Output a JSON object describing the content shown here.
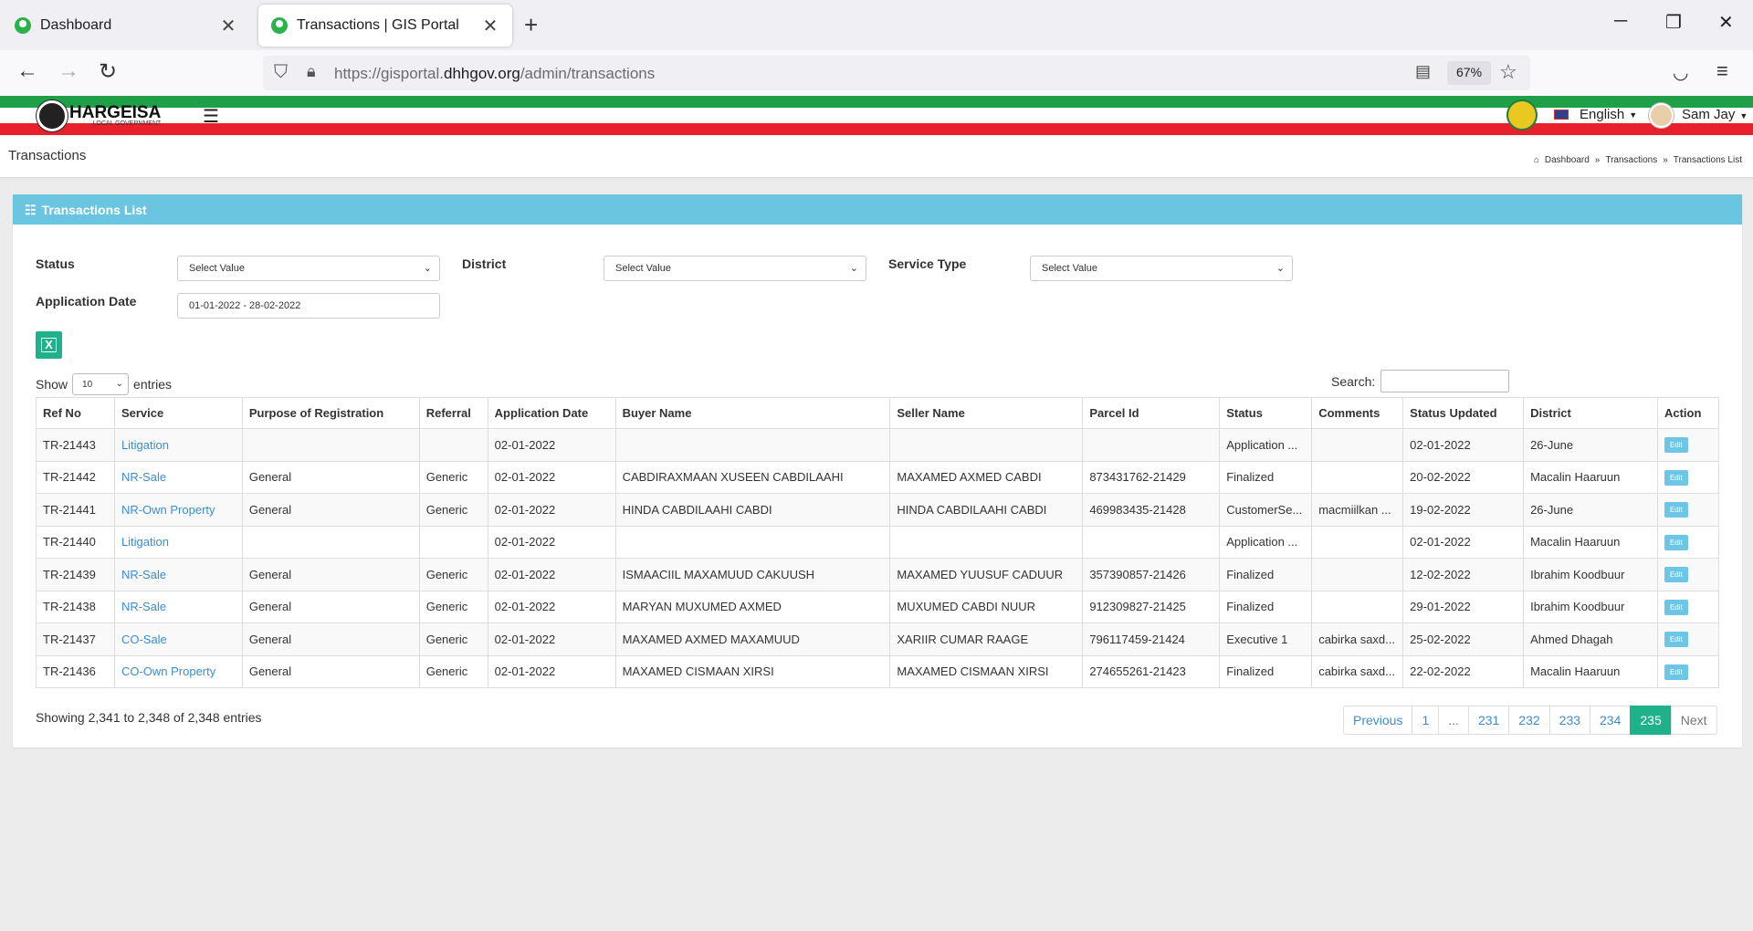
{
  "browser": {
    "tabs": [
      {
        "title": "Dashboard",
        "active": false
      },
      {
        "title": "Transactions | GIS Portal",
        "active": true
      }
    ],
    "url_prefix": "https://gisportal.",
    "url_domain": "dhhgov.org",
    "url_path": "/admin/transactions",
    "zoom": "67%"
  },
  "header": {
    "logo_text": "HARGEISA",
    "logo_subtext": "LOCAL GOVERNMENT",
    "language": "English",
    "user_name": "Sam Jay"
  },
  "page": {
    "title": "Transactions",
    "breadcrumb": [
      "Dashboard",
      "Transactions",
      "Transactions List"
    ]
  },
  "card": {
    "title": "Transactions List"
  },
  "filters": {
    "status_label": "Status",
    "status_value": "Select Value",
    "district_label": "District",
    "district_value": "Select Value",
    "service_type_label": "Service Type",
    "service_type_value": "Select Value",
    "app_date_label": "Application Date",
    "app_date_value": "01-01-2022 - 28-02-2022"
  },
  "table_controls": {
    "show_label": "Show",
    "entries_label": "entries",
    "page_length": "10",
    "search_label": "Search:"
  },
  "table": {
    "columns": [
      "Ref No",
      "Service",
      "Purpose of Registration",
      "Referral",
      "Application Date",
      "Buyer Name",
      "Seller Name",
      "Parcel Id",
      "Status",
      "Comments",
      "Status Updated",
      "District",
      "Action"
    ],
    "rows": [
      {
        "ref": "TR-21443",
        "service": "Litigation",
        "purpose": "",
        "referral": "",
        "app_date": "02-01-2022",
        "buyer": "",
        "seller": "",
        "parcel": "",
        "status": "Application ...",
        "comments": "",
        "updated": "02-01-2022",
        "district": "26-June",
        "action": "Edit"
      },
      {
        "ref": "TR-21442",
        "service": "NR-Sale",
        "purpose": "General",
        "referral": "Generic",
        "app_date": "02-01-2022",
        "buyer": "CABDIRAXMAAN XUSEEN CABDILAAHI",
        "seller": "MAXAMED AXMED CABDI",
        "parcel": "873431762-21429",
        "status": "Finalized",
        "comments": "",
        "updated": "20-02-2022",
        "district": "Macalin Haaruun",
        "action": "Edit"
      },
      {
        "ref": "TR-21441",
        "service": "NR-Own Property",
        "purpose": "General",
        "referral": "Generic",
        "app_date": "02-01-2022",
        "buyer": "HINDA CABDILAAHI CABDI",
        "seller": "HINDA CABDILAAHI CABDI",
        "parcel": "469983435-21428",
        "status": "CustomerSe...",
        "comments": "macmiilkan ...",
        "updated": "19-02-2022",
        "district": "26-June",
        "action": "Edit"
      },
      {
        "ref": "TR-21440",
        "service": "Litigation",
        "purpose": "",
        "referral": "",
        "app_date": "02-01-2022",
        "buyer": "",
        "seller": "",
        "parcel": "",
        "status": "Application ...",
        "comments": "",
        "updated": "02-01-2022",
        "district": "Macalin Haaruun",
        "action": "Edit"
      },
      {
        "ref": "TR-21439",
        "service": "NR-Sale",
        "purpose": "General",
        "referral": "Generic",
        "app_date": "02-01-2022",
        "buyer": "ISMAACIIL MAXAMUUD CAKUUSH",
        "seller": "MAXAMED YUUSUF CADUUR",
        "parcel": "357390857-21426",
        "status": "Finalized",
        "comments": "",
        "updated": "12-02-2022",
        "district": "Ibrahim Koodbuur",
        "action": "Edit"
      },
      {
        "ref": "TR-21438",
        "service": "NR-Sale",
        "purpose": "General",
        "referral": "Generic",
        "app_date": "02-01-2022",
        "buyer": "MARYAN MUXUMED AXMED",
        "seller": "MUXUMED CABDI NUUR",
        "parcel": "912309827-21425",
        "status": "Finalized",
        "comments": "",
        "updated": "29-01-2022",
        "district": "Ibrahim Koodbuur",
        "action": "Edit"
      },
      {
        "ref": "TR-21437",
        "service": "CO-Sale",
        "purpose": "General",
        "referral": "Generic",
        "app_date": "02-01-2022",
        "buyer": "MAXAMED AXMED MAXAMUUD",
        "seller": "XARIIR CUMAR RAAGE",
        "parcel": "796117459-21424",
        "status": "Executive 1",
        "comments": "cabirka saxd...",
        "updated": "25-02-2022",
        "district": "Ahmed Dhagah",
        "action": "Edit"
      },
      {
        "ref": "TR-21436",
        "service": "CO-Own Property",
        "purpose": "General",
        "referral": "Generic",
        "app_date": "02-01-2022",
        "buyer": "MAXAMED CISMAAN XIRSI",
        "seller": "MAXAMED CISMAAN XIRSI",
        "parcel": "274655261-21423",
        "status": "Finalized",
        "comments": "cabirka saxd...",
        "updated": "22-02-2022",
        "district": "Macalin Haaruun",
        "action": "Edit"
      }
    ]
  },
  "footer": {
    "info": "Showing 2,341 to 2,348 of 2,348 entries",
    "pages": [
      "Previous",
      "1",
      "...",
      "231",
      "232",
      "233",
      "234",
      "235",
      "Next"
    ],
    "active_page": "235"
  },
  "colors": {
    "card_header": "#6ac5e0",
    "accent_green": "#1fb18a",
    "link_blue": "#3b8dd1",
    "stripe_green": "#1e9f48",
    "stripe_red": "#e8202c"
  }
}
